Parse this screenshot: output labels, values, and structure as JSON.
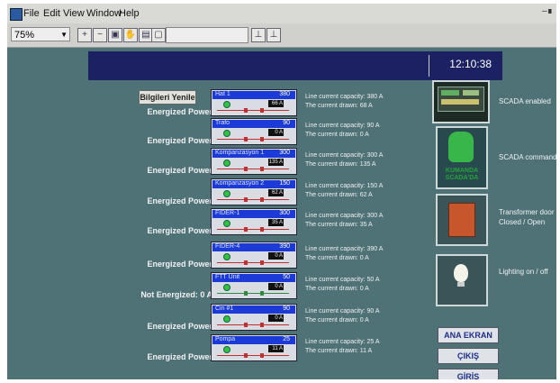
{
  "menu": {
    "items": [
      "File",
      "Edit",
      "View",
      "Window",
      "Help"
    ],
    "window_control": "–∎"
  },
  "toolbar": {
    "zoom_value": "75%"
  },
  "header": {
    "time": "12:10:38"
  },
  "refresh_button": "Bilgileri Yenile",
  "feeders": [
    {
      "status": "Energized Power",
      "name": "Hat 1",
      "capacity": "380",
      "reading": "66 A",
      "capacity_text": "Line current capacity: 380 A",
      "drawn_text": "The current drawn: 68 A",
      "energized": true
    },
    {
      "status": "Energized Power",
      "name": "Trafo",
      "capacity": "90",
      "reading": "0 A",
      "capacity_text": "Line current capacity: 90 A",
      "drawn_text": "The current drawn: 0 A",
      "energized": true
    },
    {
      "status": "Energized Power",
      "name": "Kompanzasyon 1",
      "capacity": "300",
      "reading": "135 A",
      "capacity_text": "Line current capacity: 300 A",
      "drawn_text": "The current drawn: 135 A",
      "energized": true
    },
    {
      "status": "Energized Power",
      "name": "Kompanzasyon 2",
      "capacity": "150",
      "reading": "62 A",
      "capacity_text": "Line current capacity: 150 A",
      "drawn_text": "The current drawn: 62 A",
      "energized": true
    },
    {
      "status": "Energized Power",
      "name": "FIDER-1",
      "capacity": "300",
      "reading": "35 A",
      "capacity_text": "Line current capacity: 300 A",
      "drawn_text": "The current drawn: 35 A",
      "energized": true
    },
    {
      "status": "Energized Power",
      "name": "FIDER-4",
      "capacity": "390",
      "reading": "0 A",
      "capacity_text": "Line current capacity: 390 A",
      "drawn_text": "The current drawn: 0 A",
      "energized": true
    },
    {
      "status": "Not Energized: 0 A",
      "name": "FTT Unit",
      "capacity": "50",
      "reading": "0 A",
      "capacity_text": "Line current capacity: 50 A",
      "drawn_text": "The current drawn: 0 A",
      "energized": false
    },
    {
      "status": "Energized Power",
      "name": "Cin #1",
      "capacity": "90",
      "reading": "0 A",
      "capacity_text": "Line current capacity: 90 A",
      "drawn_text": "The current drawn: 0 A",
      "energized": true
    },
    {
      "status": "Energized Power",
      "name": "Pompa",
      "capacity": "25",
      "reading": "11 A",
      "capacity_text": "Line current capacity: 25 A",
      "drawn_text": "The current drawn: 11 A",
      "energized": true
    }
  ],
  "right_panel": {
    "scada_enabled_label": "SCADA enabled",
    "scada_command_label": "SCADA command",
    "kumanda_text": "KUMANDA SCADA'DA",
    "door_label_line1": "Transformer door",
    "door_label_line2": "Closed / Open",
    "lighting_label": "Lighting on / off"
  },
  "nav": {
    "ana_ekran": "ANA EKRAN",
    "cikis": "ÇIKIŞ",
    "giris": "GİRİŞ"
  },
  "colors": {
    "header_bg": "#1b2162",
    "panel_bar": "#1c3ad6",
    "bg": "#4f7277",
    "hand": "#39b64a",
    "door": "#c8562c"
  }
}
